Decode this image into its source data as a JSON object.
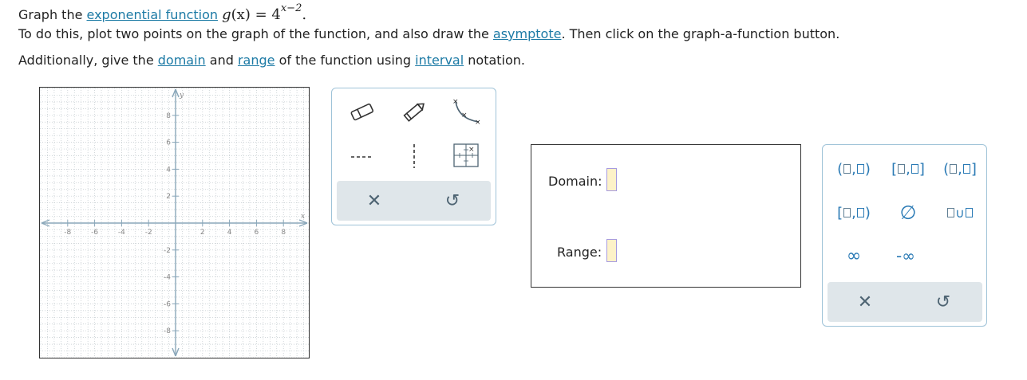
{
  "prompt": {
    "line1_prefix": "Graph the ",
    "line1_link": "exponential function",
    "func_name": "g",
    "func_arg": "(x)",
    "func_eq": " = 4",
    "func_exp": "x−2",
    "func_end": ".",
    "line2_prefix": "To do this, plot two points on the graph of the function, and also draw the ",
    "line2_link": "asymptote",
    "line2_suffix": ". Then click on the graph-a-function button.",
    "line3_prefix": "Additionally, give the ",
    "line3_link1": "domain",
    "line3_mid1": " and ",
    "line3_link2": "range",
    "line3_mid2": " of the function using ",
    "line3_link3": "interval",
    "line3_suffix": " notation."
  },
  "graph": {
    "x_axis_label": "x",
    "y_axis_label": "y",
    "x_ticks": [
      -8,
      -6,
      -4,
      -2,
      2,
      4,
      6,
      8
    ],
    "y_ticks": [
      8,
      6,
      4,
      2,
      -2,
      -4,
      -6,
      -8
    ],
    "x_min": -10,
    "x_max": 10,
    "y_min": -10,
    "y_max": 10,
    "axis_color": "#8aa7ba",
    "grid_color": "#bfc7cc"
  },
  "graph_tools": {
    "row1": [
      "eraser-icon",
      "pencil-icon",
      "exponential-curve-icon"
    ],
    "row2": [
      "dashed-line-icon",
      "vertical-dashed-line-icon",
      "graph-function-icon"
    ],
    "clear_symbol": "✕",
    "undo_symbol": "↺"
  },
  "answer": {
    "domain_label": "Domain:",
    "range_label": "Range:"
  },
  "keypad": {
    "open_interval": "(□,□)",
    "closed_interval": "[□,□]",
    "left_open_interval": "(□,□]",
    "left_closed_interval": "[□,□)",
    "empty_set": "∅",
    "union": "□∪□",
    "infinity": "∞",
    "neg_infinity": "-∞",
    "clear_symbol": "✕",
    "undo_symbol": "↺"
  },
  "colors": {
    "link": "#1c7aa5",
    "panel_border": "#9fc3d8",
    "keypad_blue": "#2a7ab5",
    "toolbar_grey": "#dfe6ea",
    "input_fill": "#fdf2c8",
    "input_border": "#a69ae0"
  }
}
